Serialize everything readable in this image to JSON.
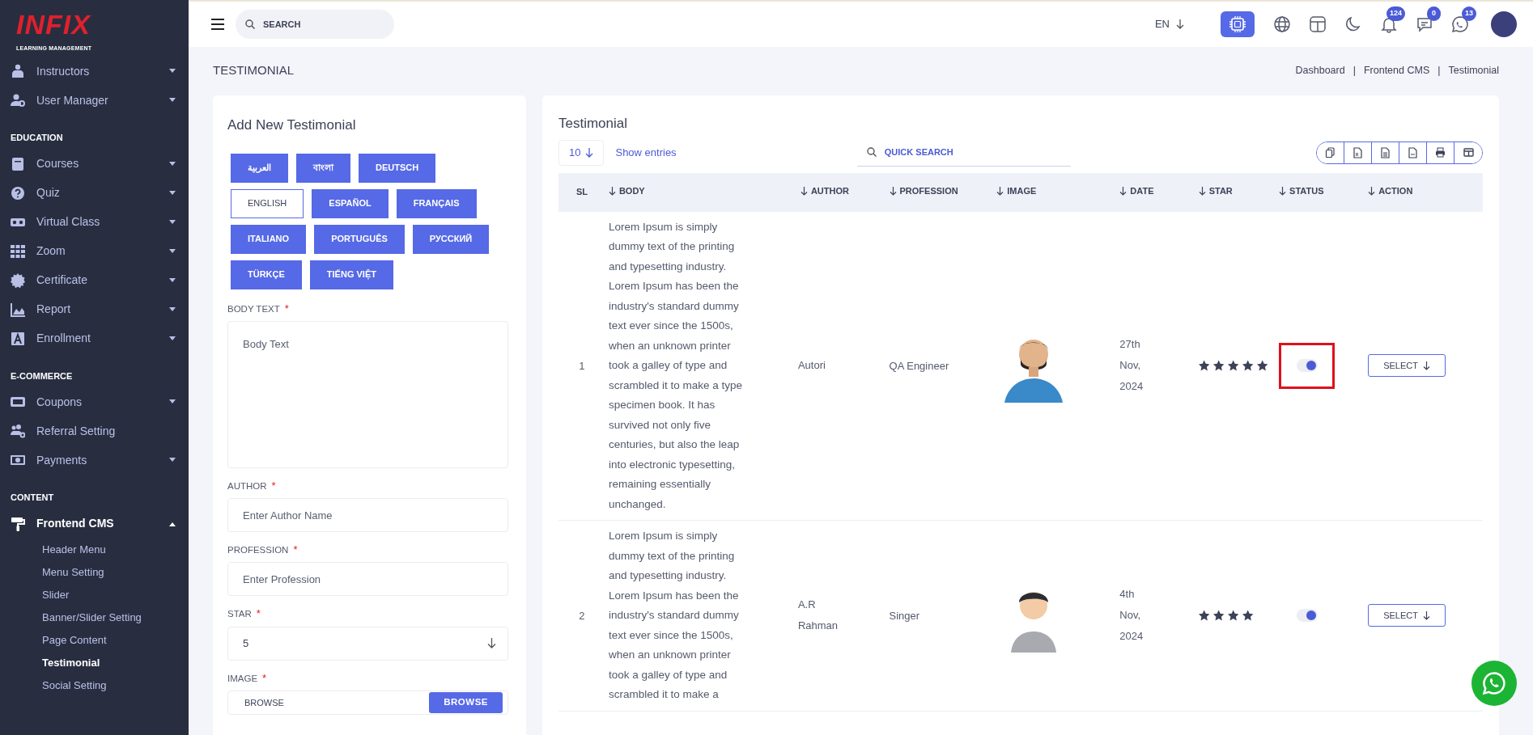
{
  "sidebar": {
    "logo": {
      "title": "INFIX",
      "subtitle": "LEARNING MANAGEMENT"
    },
    "items": [
      {
        "kind": "item",
        "label": "Instructors",
        "expanded": false
      },
      {
        "kind": "item",
        "label": "User Manager",
        "expanded": false
      },
      {
        "kind": "heading",
        "label": "EDUCATION"
      },
      {
        "kind": "item",
        "label": "Courses",
        "expanded": false
      },
      {
        "kind": "item",
        "label": "Quiz",
        "expanded": false
      },
      {
        "kind": "item",
        "label": "Virtual Class",
        "expanded": false
      },
      {
        "kind": "item",
        "label": "Zoom",
        "expanded": false
      },
      {
        "kind": "item",
        "label": "Certificate",
        "expanded": false
      },
      {
        "kind": "item",
        "label": "Report",
        "expanded": false
      },
      {
        "kind": "item",
        "label": "Enrollment",
        "expanded": false
      },
      {
        "kind": "heading",
        "label": "E-COMMERCE"
      },
      {
        "kind": "item",
        "label": "Coupons",
        "expanded": false
      },
      {
        "kind": "item",
        "label": "Referral Setting"
      },
      {
        "kind": "item",
        "label": "Payments",
        "expanded": false
      },
      {
        "kind": "heading",
        "label": "CONTENT"
      },
      {
        "kind": "item",
        "label": "Frontend CMS",
        "expanded": true,
        "children": [
          {
            "label": "Header Menu",
            "selected": false
          },
          {
            "label": "Menu Setting",
            "selected": false
          },
          {
            "label": "Slider",
            "selected": false
          },
          {
            "label": "Banner/Slider Setting",
            "selected": false
          },
          {
            "label": "Page Content",
            "selected": false
          },
          {
            "label": "Testimonial",
            "selected": true
          },
          {
            "label": "Social Setting",
            "selected": false
          }
        ]
      }
    ]
  },
  "topbar": {
    "search": {
      "placeholder": "SEARCH"
    },
    "language": "EN",
    "badges": [
      "124",
      "0",
      "13"
    ]
  },
  "page": {
    "title": "TESTIMONIAL",
    "breadcrumb": [
      "Dashboard",
      "Frontend CMS",
      "Testimonial"
    ],
    "separator": "|"
  },
  "form": {
    "title": "Add New Testimonial",
    "languages": [
      {
        "label": "العربية",
        "selected": false
      },
      {
        "label": "বাংলা",
        "selected": false
      },
      {
        "label": "DEUTSCH",
        "selected": false
      },
      {
        "label": "ENGLISH",
        "selected": true
      },
      {
        "label": "ESPAÑOL",
        "selected": false
      },
      {
        "label": "FRANÇAIS",
        "selected": false
      },
      {
        "label": "ITALIANO",
        "selected": false
      },
      {
        "label": "PORTUGUÊS",
        "selected": false
      },
      {
        "label": "РУССКИЙ",
        "selected": false
      },
      {
        "label": "TÜRKÇE",
        "selected": false
      },
      {
        "label": "TIẾNG VIỆT",
        "selected": false
      }
    ],
    "fields": [
      {
        "kind": "textarea",
        "label": "BODY TEXT",
        "marker": "*",
        "placeholder": "Body Text"
      },
      {
        "kind": "input",
        "label": "AUTHOR",
        "marker": "*",
        "placeholder": "Enter Author Name"
      },
      {
        "kind": "input",
        "label": "PROFESSION",
        "marker": "*",
        "placeholder": "Enter Profession"
      },
      {
        "kind": "select",
        "label": "STAR",
        "marker": "*",
        "value": "5"
      },
      {
        "kind": "file",
        "label": "IMAGE",
        "marker": "*",
        "placeholder": "BROWSE",
        "button": "BROWSE"
      }
    ]
  },
  "table": {
    "title": "Testimonial",
    "page_size": "10",
    "show_entries": "Show entries",
    "search": {
      "placeholder": "QUICK SEARCH"
    },
    "columns": [
      {
        "label": "SL",
        "sortable": false
      },
      {
        "label": "BODY",
        "sortable": true
      },
      {
        "label": "AUTHOR",
        "sortable": true
      },
      {
        "label": "PROFESSION",
        "sortable": true
      },
      {
        "label": "IMAGE",
        "sortable": true
      },
      {
        "label": "DATE",
        "sortable": true
      },
      {
        "label": "STAR",
        "sortable": true
      },
      {
        "label": "STATUS",
        "sortable": true
      },
      {
        "label": "ACTION",
        "sortable": true
      }
    ],
    "rows": [
      {
        "sl": "1",
        "body": "Lorem Ipsum is simply dummy text of the printing and typesetting industry. Lorem Ipsum has been the industry's standard dummy text ever since the 1500s, when an unknown printer took a galley of type and scrambled it to make a type specimen book. It has survived not only five centuries, but also the leap into electronic typesetting, remaining essentially unchanged.",
        "author": "Autori",
        "profession": "QA Engineer",
        "date": "27th Nov, 2024",
        "stars": 5,
        "on": true,
        "highlighted": true,
        "action": "SELECT"
      },
      {
        "sl": "2",
        "body": "Lorem Ipsum is simply dummy text of the printing and typesetting industry. Lorem Ipsum has been the industry's standard dummy text ever since the 1500s, when an unknown printer took a galley of type and scrambled it to make a",
        "author": "A.R Rahman",
        "profession": "Singer",
        "date": "4th Nov, 2024",
        "stars": 4,
        "on": true,
        "highlighted": false,
        "action": "SELECT"
      }
    ]
  }
}
